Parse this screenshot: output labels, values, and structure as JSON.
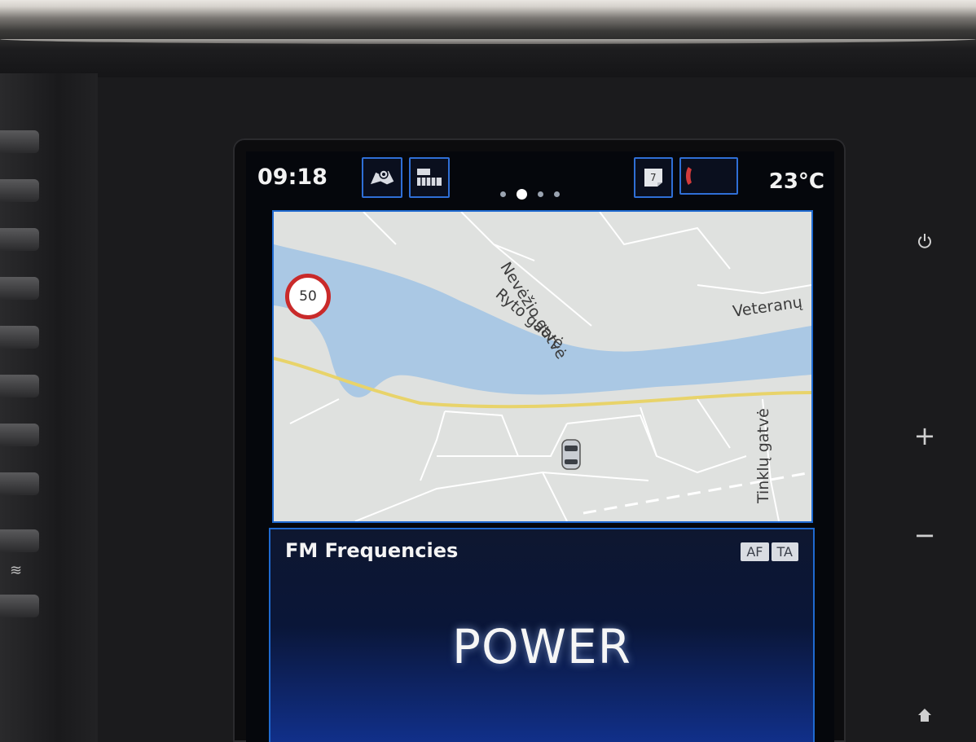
{
  "status_bar": {
    "time": "09:18",
    "temperature": "23°C",
    "shortcuts": [
      {
        "icon": "map-navigation-icon"
      },
      {
        "icon": "radio-media-icon"
      }
    ],
    "notifications": [
      {
        "icon": "calendar-icon",
        "value": "7"
      },
      {
        "icon": "phone-icon",
        "value": ""
      }
    ],
    "pager": {
      "pages": 4,
      "active_index": 1
    }
  },
  "map": {
    "speed_limit": "50",
    "streets": [
      "Nevėžio gatvė",
      "Ryto gatvė",
      "Veteranų",
      "Tinklų gatvė"
    ],
    "colors": {
      "water": "#aac8e4",
      "road_main": "#e8d36a",
      "background": "#dfe1df"
    }
  },
  "radio": {
    "title": "FM Frequencies",
    "badges": [
      "AF",
      "TA"
    ],
    "station": "POWER"
  },
  "hardware_controls": [
    {
      "icon": "power-icon",
      "label": "⏻"
    },
    {
      "icon": "volume-up-icon",
      "label": "+"
    },
    {
      "icon": "volume-down-icon",
      "label": "−"
    },
    {
      "icon": "home-icon",
      "label": "⌂"
    }
  ],
  "colors": {
    "accent": "#2f6fd6",
    "screen_bg": "#05070c",
    "radio_gradient_end": "#11308b"
  }
}
